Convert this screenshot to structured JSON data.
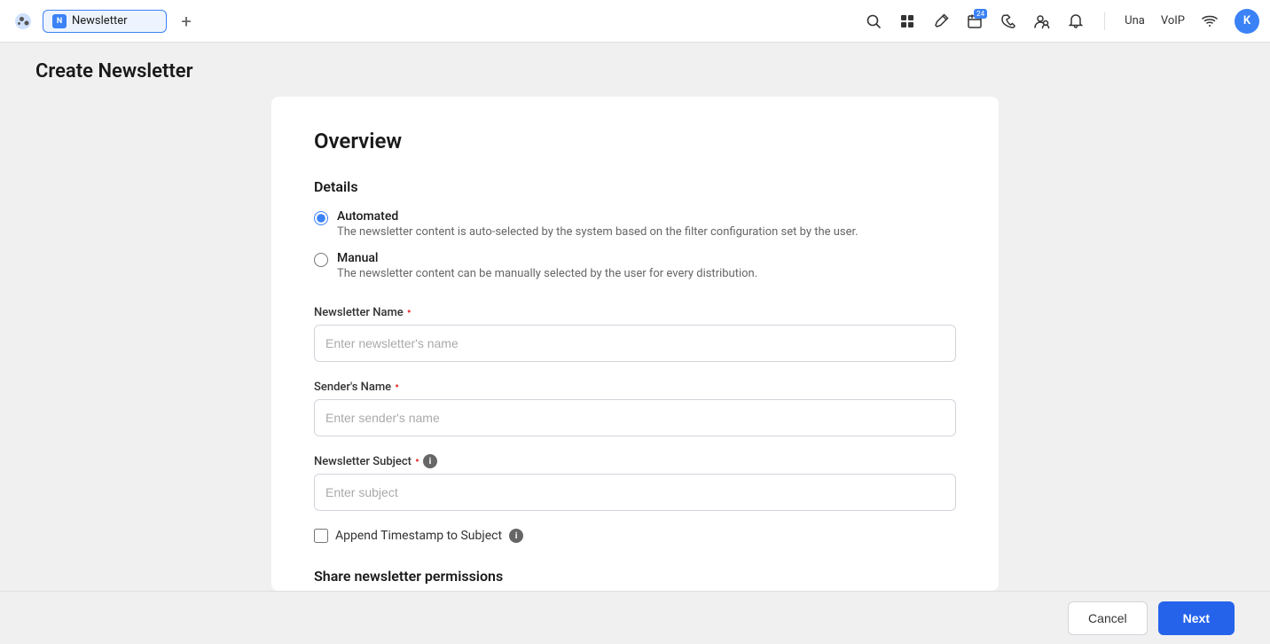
{
  "topbar": {
    "tab_label": "Newsletter",
    "tab_add_label": "+",
    "username": "Una",
    "voip_label": "VoIP",
    "avatar_initials": "K",
    "calendar_badge": "24"
  },
  "page": {
    "title": "Create Newsletter"
  },
  "form": {
    "section_overview": "Overview",
    "section_details": "Details",
    "radio_automated_label": "Automated",
    "radio_automated_desc": "The newsletter content is auto-selected by the system based on the filter configuration set by the user.",
    "radio_manual_label": "Manual",
    "radio_manual_desc": "The newsletter content can be manually selected by the user for every distribution.",
    "field_newsletter_name_label": "Newsletter Name",
    "field_newsletter_name_placeholder": "Enter newsletter's name",
    "field_sender_name_label": "Sender's Name",
    "field_sender_name_placeholder": "Enter sender's name",
    "field_subject_label": "Newsletter Subject",
    "field_subject_placeholder": "Enter subject",
    "checkbox_append_label": "Append Timestamp to Subject",
    "section_permissions": "Share newsletter permissions"
  },
  "footer": {
    "cancel_label": "Cancel",
    "next_label": "Next"
  }
}
